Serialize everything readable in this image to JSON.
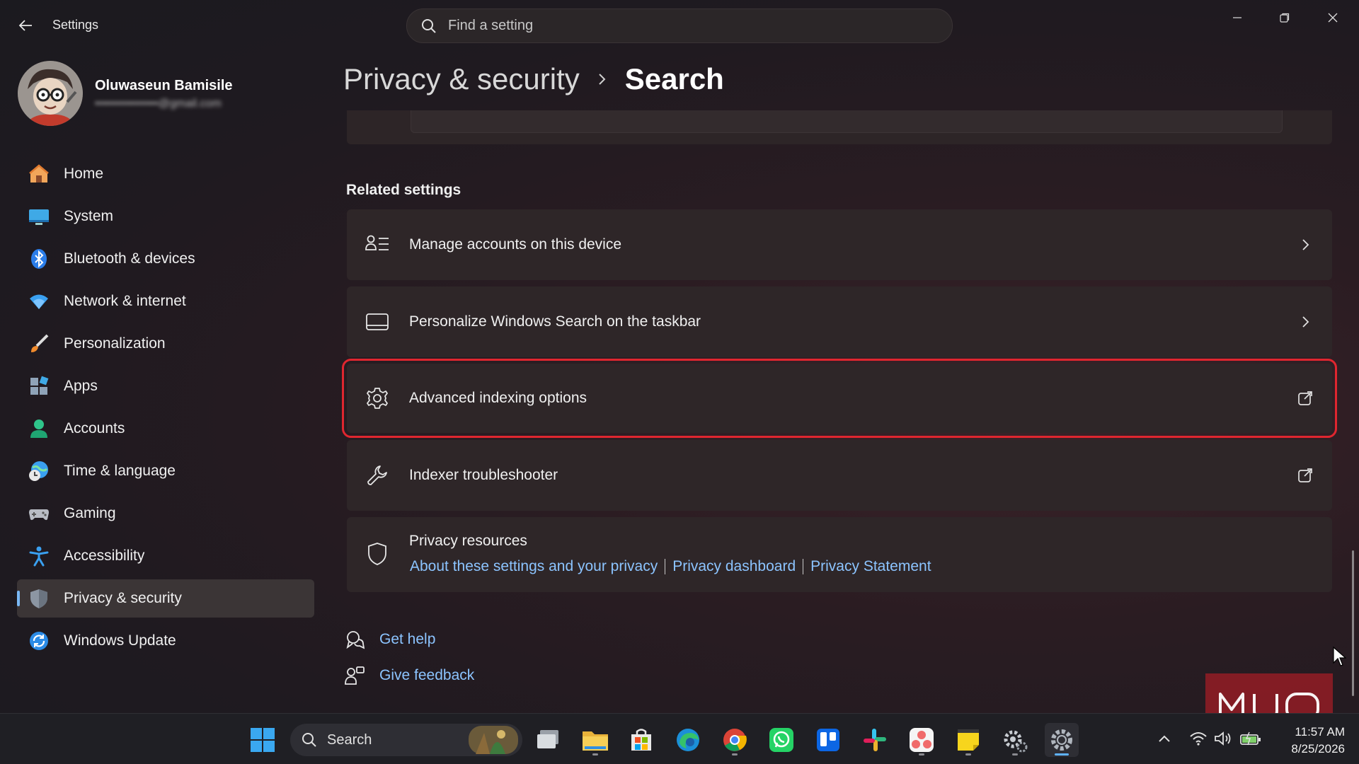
{
  "window": {
    "app_title": "Settings",
    "search_placeholder": "Find a setting"
  },
  "profile": {
    "name": "Oluwaseun Bamisile",
    "email": "••••••••••••••••@gmail.com"
  },
  "sidebar": {
    "items": [
      {
        "label": "Home",
        "icon": "home-icon"
      },
      {
        "label": "System",
        "icon": "system-icon"
      },
      {
        "label": "Bluetooth & devices",
        "icon": "bluetooth-icon"
      },
      {
        "label": "Network & internet",
        "icon": "wifi-icon"
      },
      {
        "label": "Personalization",
        "icon": "brush-icon"
      },
      {
        "label": "Apps",
        "icon": "apps-icon"
      },
      {
        "label": "Accounts",
        "icon": "accounts-icon"
      },
      {
        "label": "Time & language",
        "icon": "globe-clock-icon"
      },
      {
        "label": "Gaming",
        "icon": "gamepad-icon"
      },
      {
        "label": "Accessibility",
        "icon": "accessibility-icon"
      },
      {
        "label": "Privacy & security",
        "icon": "shield-icon",
        "active": true
      },
      {
        "label": "Windows Update",
        "icon": "update-icon"
      }
    ]
  },
  "header": {
    "parent": "Privacy & security",
    "current": "Search"
  },
  "related": {
    "title": "Related settings",
    "items": [
      {
        "label": "Manage accounts on this device",
        "icon": "accounts-list-icon",
        "trail": "chevron-right-icon"
      },
      {
        "label": "Personalize Windows Search on the taskbar",
        "icon": "taskbar-icon",
        "trail": "chevron-right-icon"
      },
      {
        "label": "Advanced indexing options",
        "icon": "gear-icon",
        "trail": "external-link-icon",
        "highlighted": true
      },
      {
        "label": "Indexer troubleshooter",
        "icon": "wrench-icon",
        "trail": "external-link-icon"
      }
    ],
    "privacy": {
      "title": "Privacy resources",
      "links": [
        "About these settings and your privacy",
        "Privacy dashboard",
        "Privacy Statement"
      ]
    }
  },
  "help": {
    "get_help": "Get help",
    "give_feedback": "Give feedback"
  },
  "taskbar": {
    "search_label": "Search",
    "time": "11:57 AM",
    "date": "8/25/2026"
  },
  "colors": {
    "accent": "#7ab8f5",
    "link": "#8cc4ff",
    "highlight_border": "#e0262f",
    "watermark": "#d01e28"
  }
}
